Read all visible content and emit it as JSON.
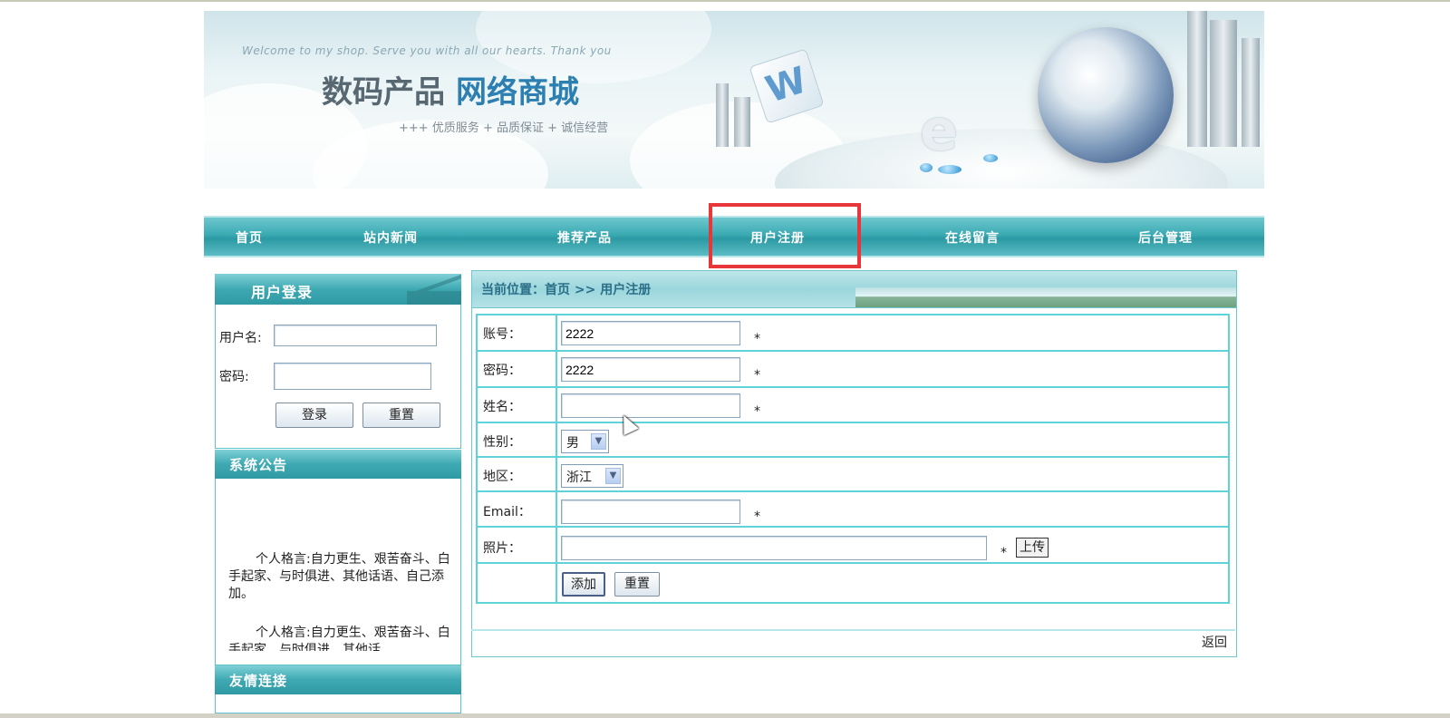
{
  "banner": {
    "welcome": "Welcome to my shop. Serve you with all our hearts. Thank you",
    "title_a": "数码产品",
    "title_b": "网络商城",
    "slogan": "+++ 优质服务 + 品质保证 + 诚信经营",
    "cube_letter": "W",
    "e_glyph": "e"
  },
  "nav": {
    "items": [
      "首页",
      "站内新闻",
      "推荐产品",
      "用户注册",
      "在线留言",
      "后台管理"
    ],
    "highlighted": "用户注册",
    "highlight_color": "#e8373a"
  },
  "login": {
    "title": "用户登录",
    "username_label": "用户名:",
    "password_label": "密码:",
    "username_value": "",
    "password_value": "",
    "login_button": "登录",
    "reset_button": "重置"
  },
  "notice": {
    "title": "系统公告",
    "items": [
      "个人格言:自力更生、艰苦奋斗、白手起家、与时俱进、其他话语、自己添加。",
      "个人格言:自力更生、艰苦奋斗、白手起家、与时俱进、其他话"
    ]
  },
  "links": {
    "title": "友情连接"
  },
  "breadcrumb": "当前位置：首页 >> 用户注册",
  "form": {
    "account_label": "账号：",
    "account_value": "2222",
    "password_label": "密码：",
    "password_value": "2222",
    "name_label": "姓名：",
    "name_value": "",
    "gender_label": "性别：",
    "gender_value": "男",
    "region_label": "地区：",
    "region_value": "浙江",
    "email_label": "Email：",
    "email_value": "",
    "photo_label": "照片：",
    "photo_value": "",
    "required_mark": "*",
    "upload_button": "上传",
    "add_button": "添加",
    "reset_button": "重置"
  },
  "back_link": "返回",
  "colors": {
    "nav_teal": "#3aaab3",
    "border_cyan": "#5fd3d9",
    "crumb_text": "#2b6f88"
  }
}
